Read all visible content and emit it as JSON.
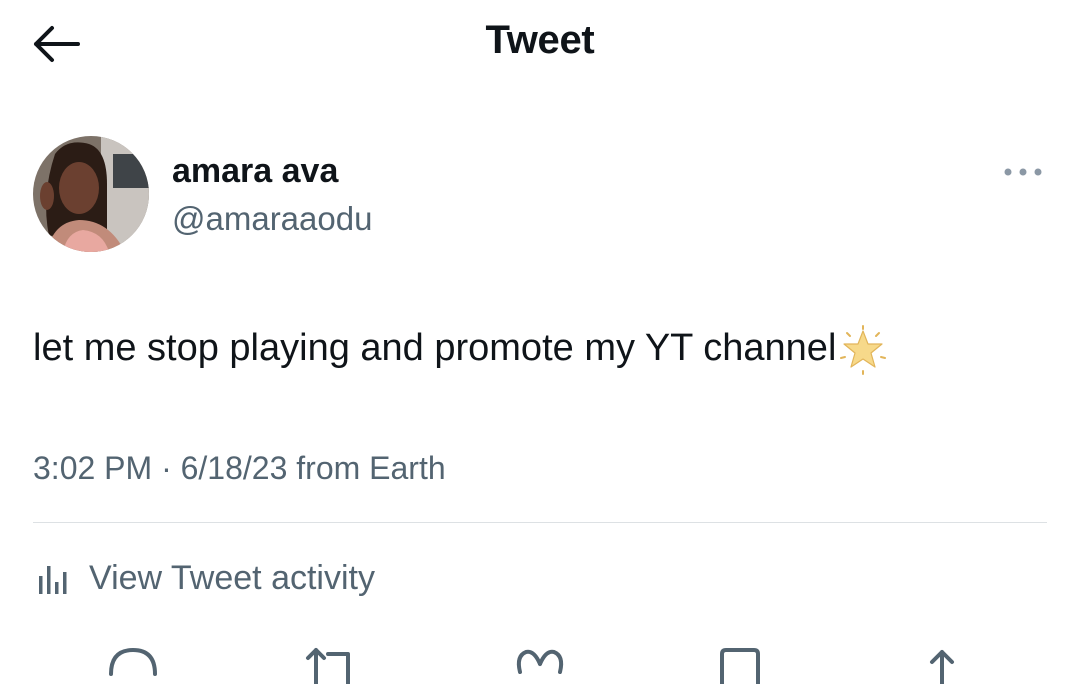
{
  "header": {
    "title": "Tweet",
    "back_icon": "arrow-left-icon"
  },
  "author": {
    "display_name": "amara ava",
    "handle": "@amaraaodu",
    "more_icon": "more-dots-icon"
  },
  "tweet": {
    "text": "let me stop playing and promote my YT channel",
    "emoji": "star-emoji",
    "time": "3:02 PM",
    "separator": "·",
    "date": "6/18/23",
    "source": "from Earth"
  },
  "activity": {
    "label": "View Tweet activity",
    "icon": "analytics-bars-icon"
  },
  "actions": [
    {
      "icon": "reply-icon"
    },
    {
      "icon": "retweet-icon"
    },
    {
      "icon": "like-icon"
    },
    {
      "icon": "bookmark-icon"
    },
    {
      "icon": "share-icon"
    }
  ],
  "colors": {
    "text_primary": "#0f1419",
    "text_secondary": "#536471",
    "divider": "#dde1e4",
    "background": "#ffffff"
  }
}
